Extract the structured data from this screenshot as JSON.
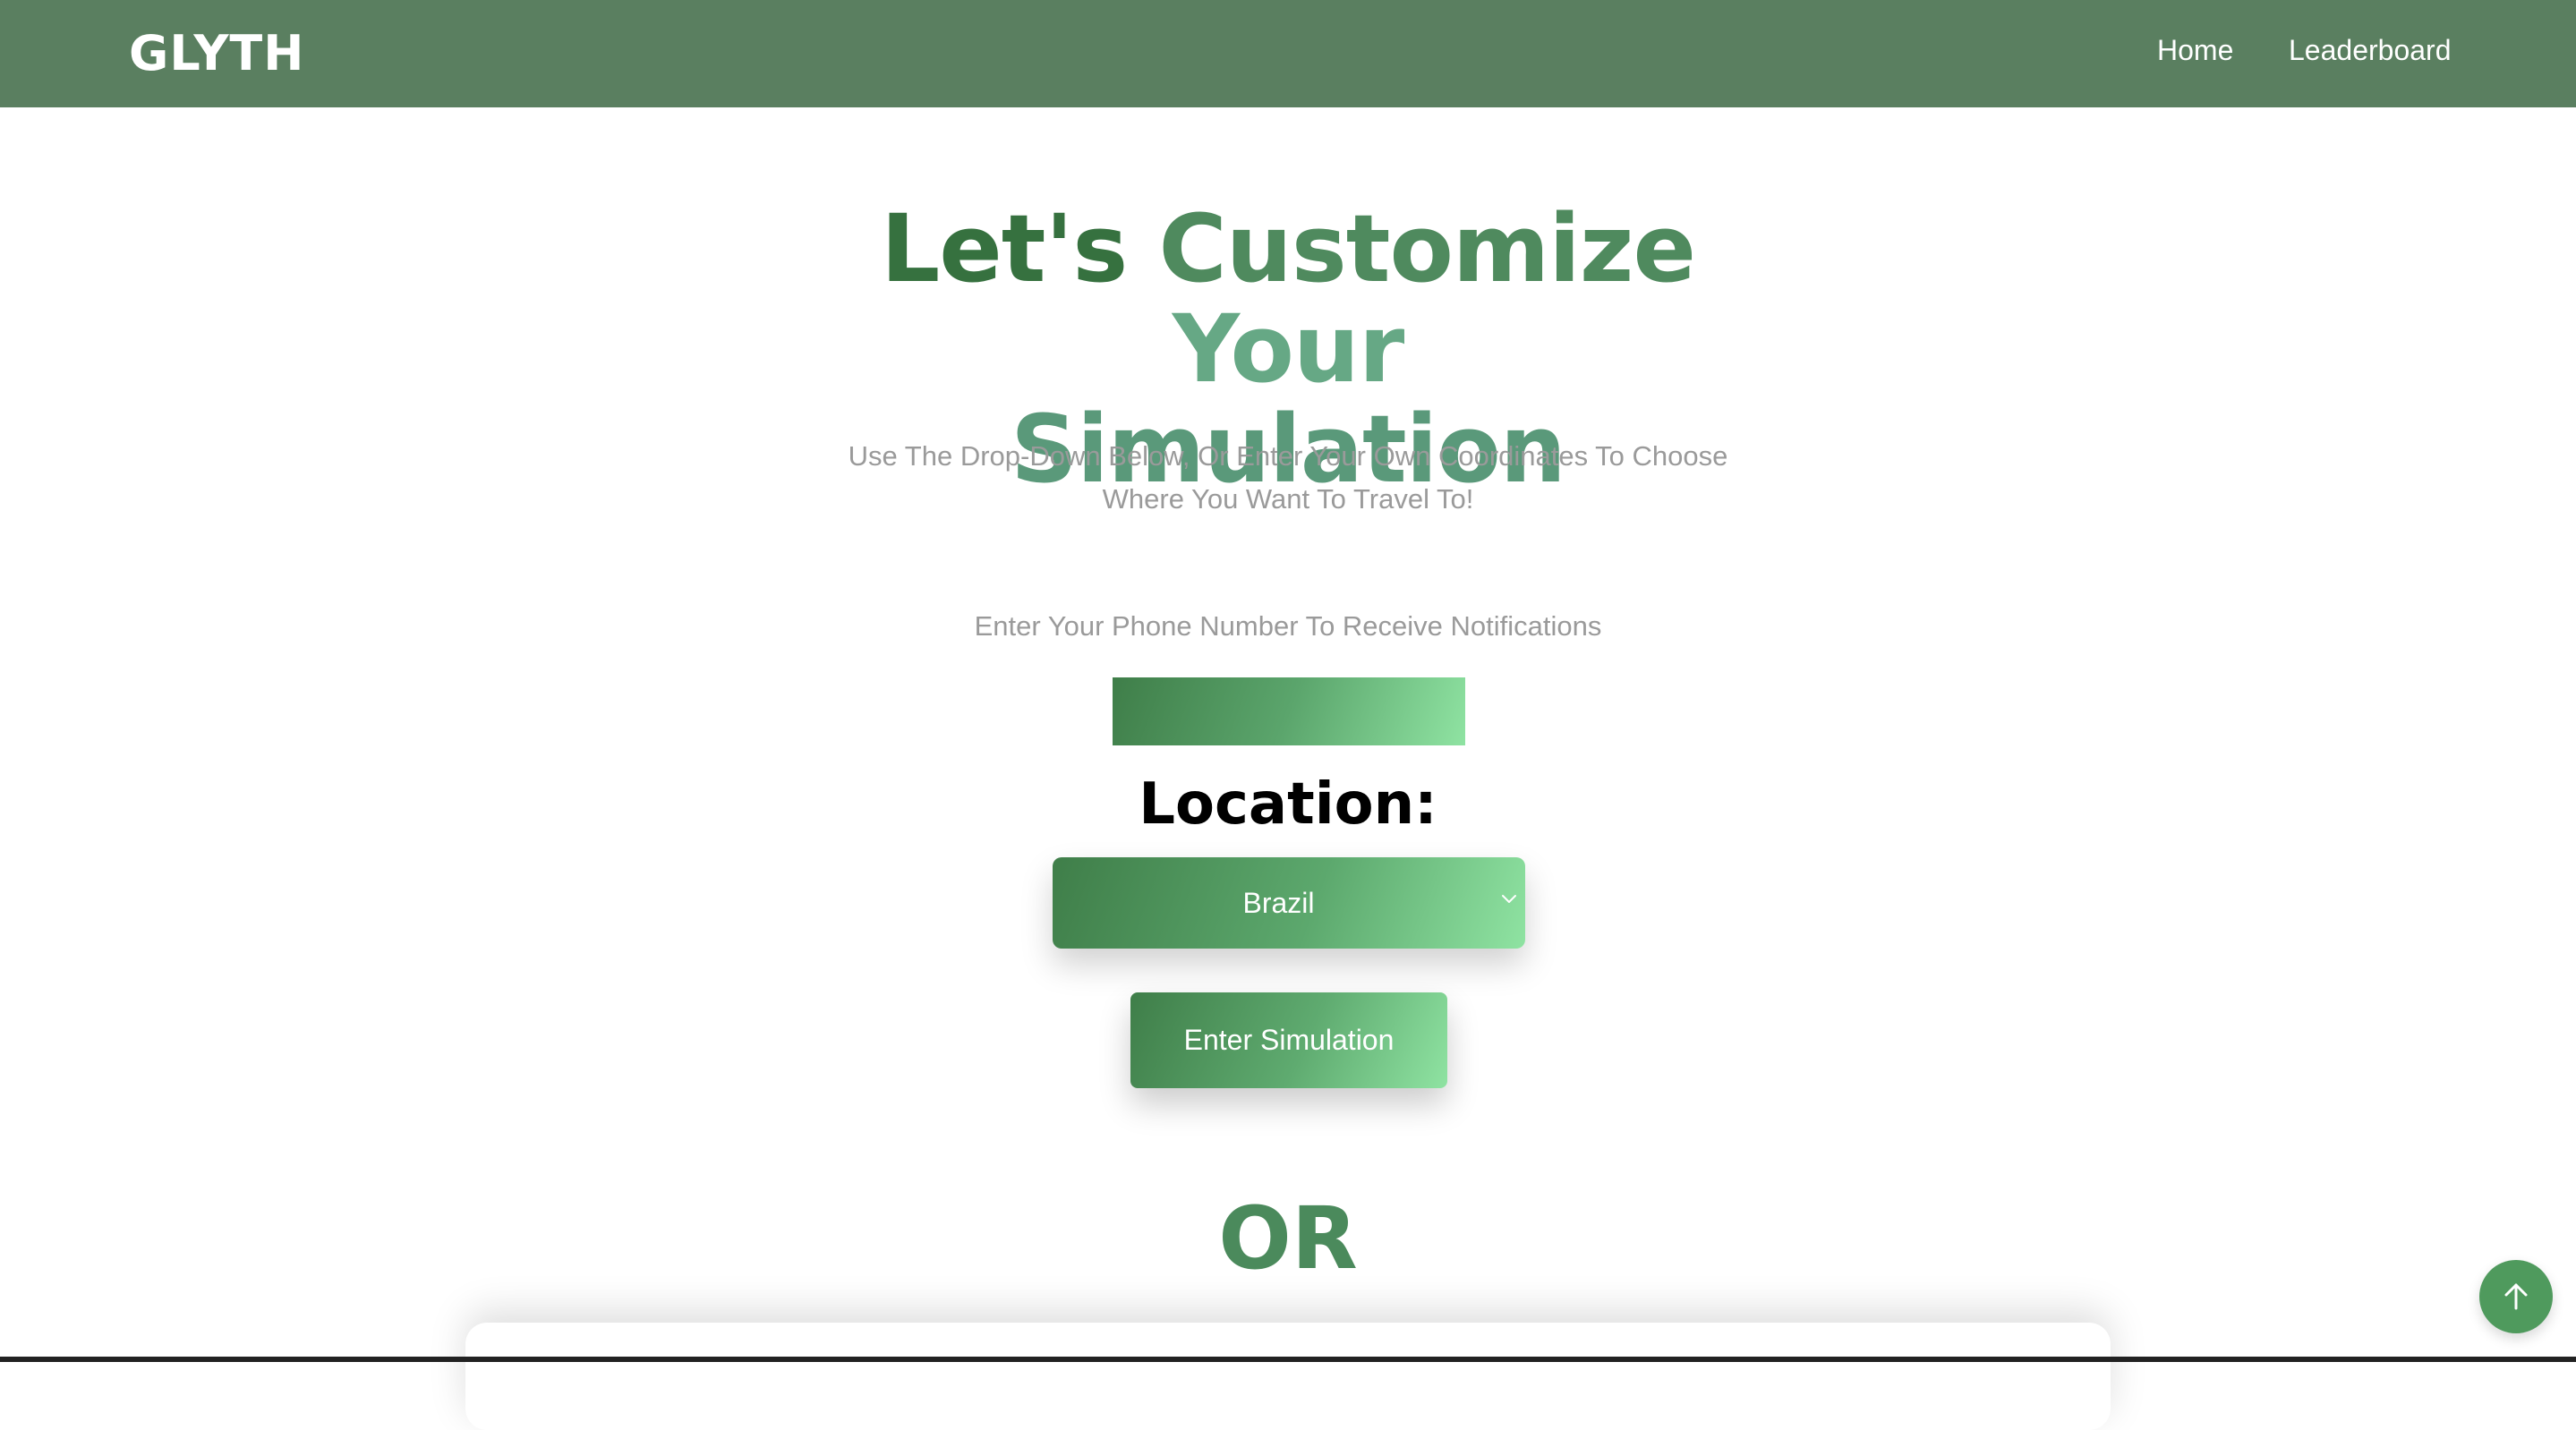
{
  "navbar": {
    "logo": "GLYTH",
    "links": [
      {
        "label": "Home"
      },
      {
        "label": "Leaderboard"
      }
    ]
  },
  "hero": {
    "title_part1": "Let's",
    "title_part2": "Customize",
    "title_part3": "Your",
    "title_line2": "Simulation",
    "subtitle_line1": "Use The Drop-Down Below, Or Enter Your Own Coordinates To Choose",
    "subtitle_line2": "Where You Want To Travel To!"
  },
  "phone": {
    "label": "Enter Your Phone Number To Receive Notifications",
    "value": "",
    "placeholder": ""
  },
  "location": {
    "label": "Location:",
    "selected": "Brazil"
  },
  "actions": {
    "enter_label": "Enter Simulation",
    "or_label": "OR"
  },
  "icons": {
    "dropdown": "chevron-down-icon",
    "scroll_top": "arrow-up-icon"
  },
  "colors": {
    "navbar": "#5a7f60",
    "accent_dark": "#3f7e49",
    "accent_light": "#8fe3a2",
    "or_text": "#4b8a5c",
    "scroll_button": "#4f9a5d"
  }
}
